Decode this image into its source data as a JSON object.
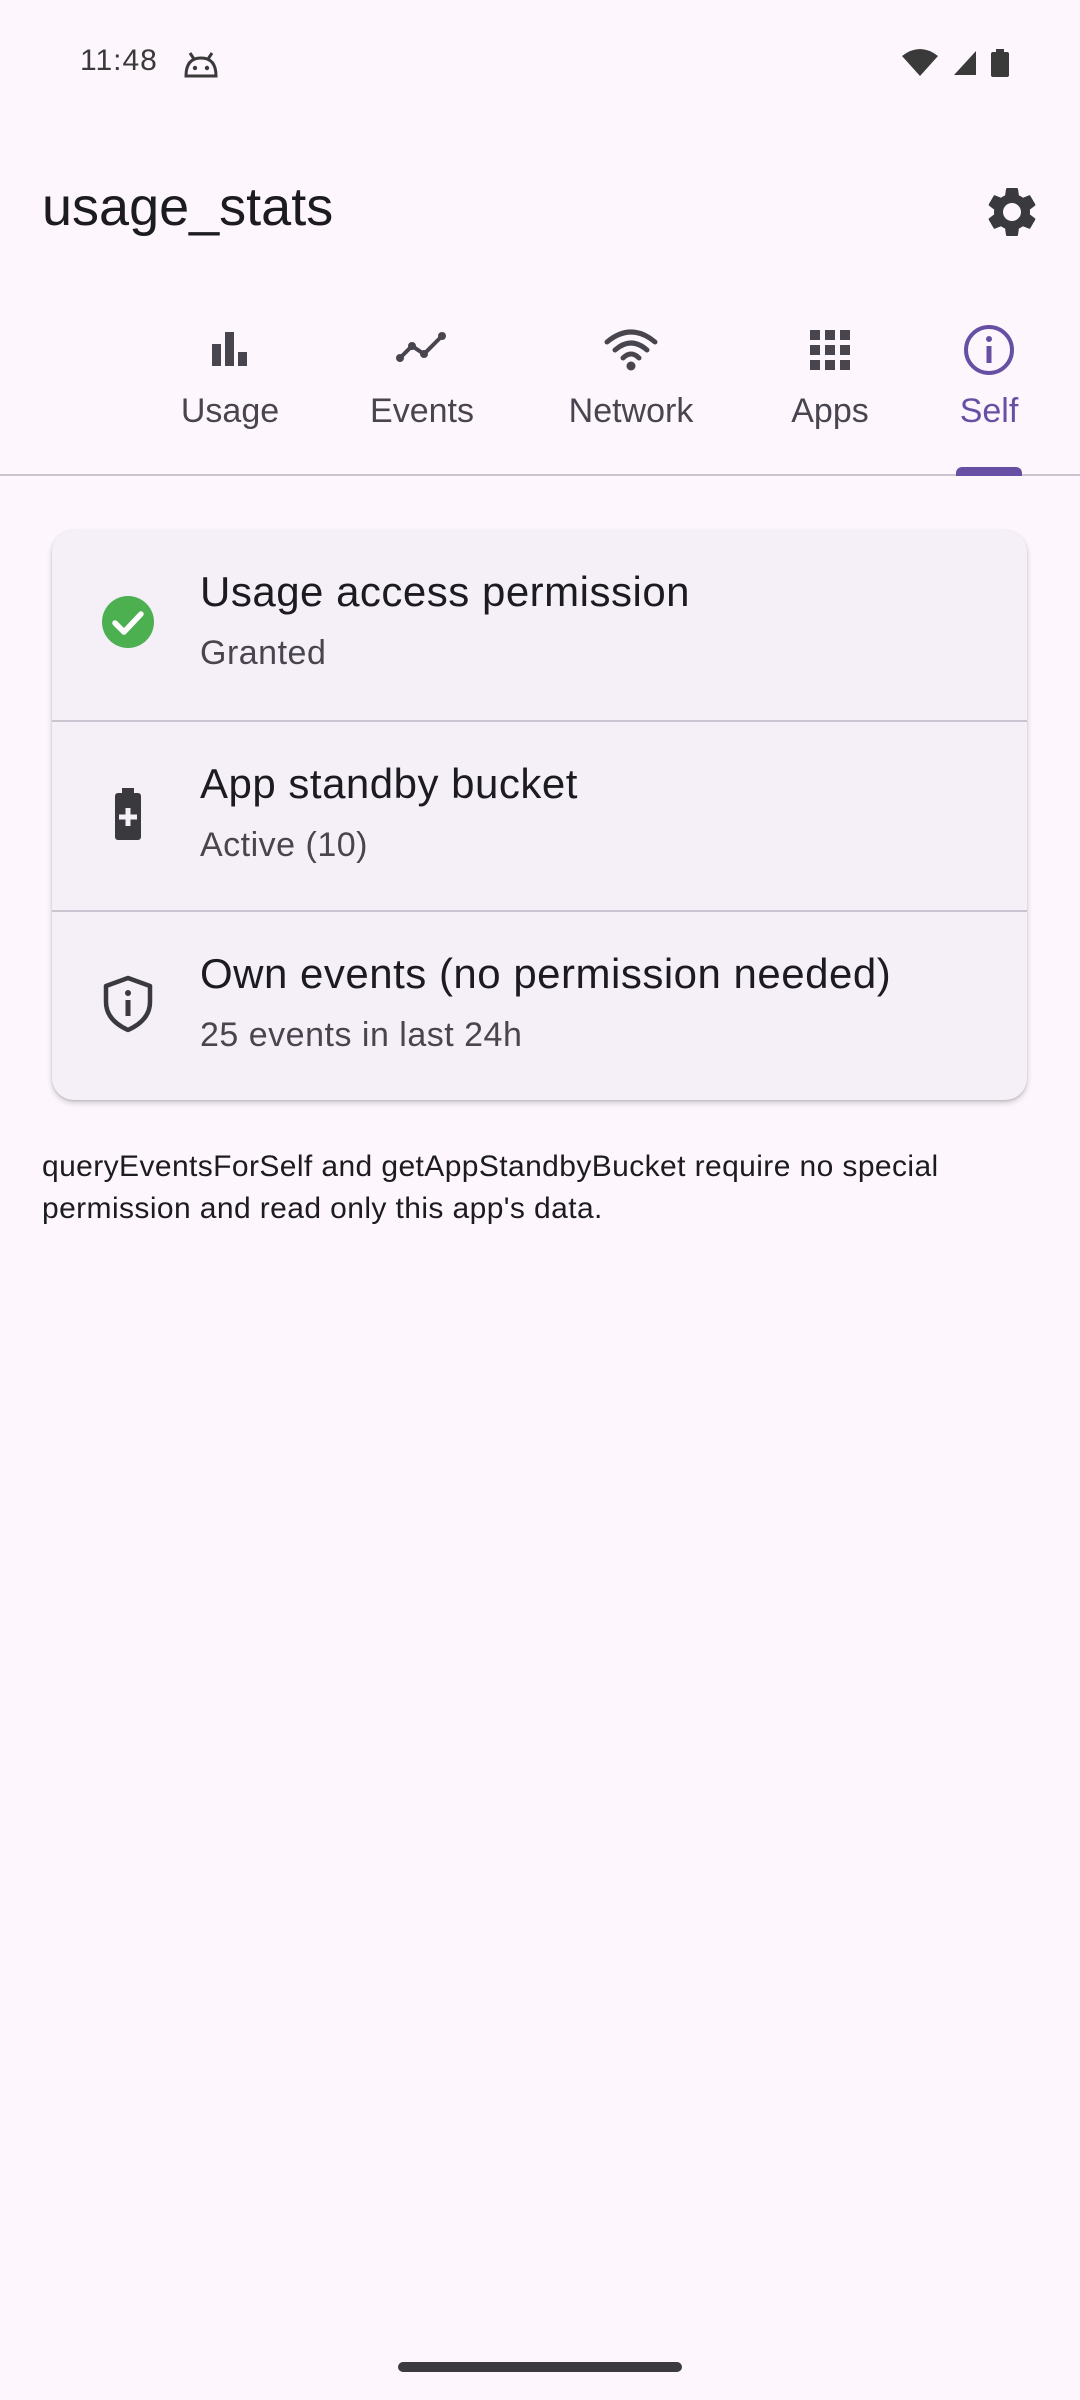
{
  "status_bar": {
    "time": "11:48"
  },
  "app_bar": {
    "title": "usage_stats"
  },
  "tabs": [
    {
      "label": "Usage",
      "icon": "bar-chart-icon"
    },
    {
      "label": "Events",
      "icon": "timeline-icon"
    },
    {
      "label": "Network",
      "icon": "wifi-icon"
    },
    {
      "label": "Apps",
      "icon": "apps-grid-icon"
    },
    {
      "label": "Self",
      "icon": "info-icon",
      "selected": true
    }
  ],
  "self_card": {
    "rows": [
      {
        "title": "Usage access permission",
        "subtitle": "Granted",
        "icon": "check-circle-icon"
      },
      {
        "title": "App standby bucket",
        "subtitle": "Active (10)",
        "icon": "battery-plus-icon"
      },
      {
        "title": "Own events (no permission needed)",
        "subtitle": "25 events in last 24h",
        "icon": "shield-info-icon"
      }
    ]
  },
  "footnote": "queryEventsForSelf and getAppStandbyBucket require no special permission and read only this app's data.",
  "colors": {
    "accent": "#6750a4",
    "granted_green": "#4caf50",
    "background": "#fdf7fd",
    "card": "#f5eff7"
  }
}
